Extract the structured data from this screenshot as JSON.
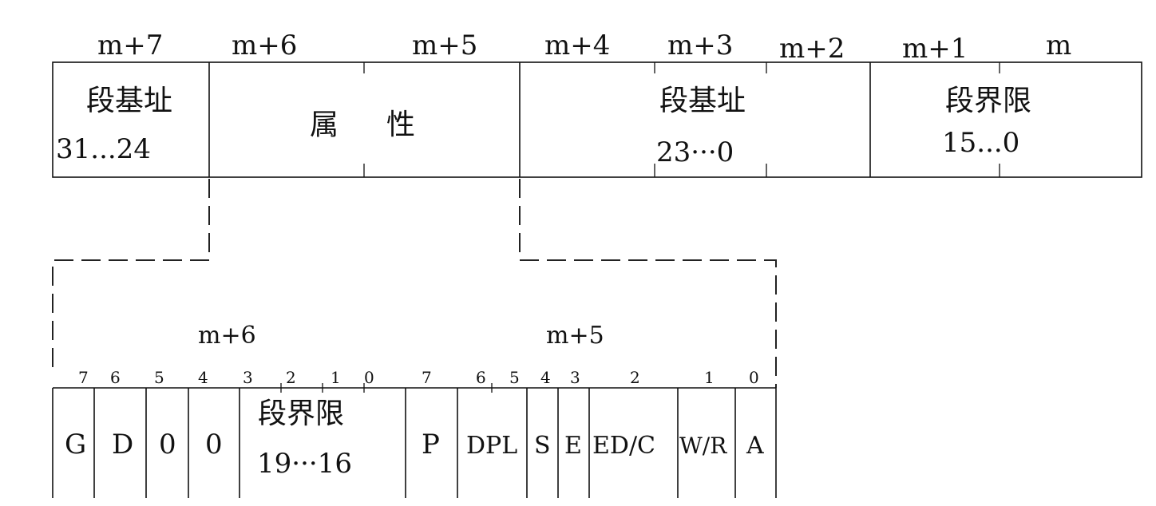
{
  "descriptor": {
    "byte_labels": [
      "m+7",
      "m+6",
      "m+5",
      "m+4",
      "m+3",
      "m+2",
      "m+1",
      "m"
    ],
    "fields": {
      "base_high": {
        "name": "段基址",
        "range": "31...24"
      },
      "attributes": {
        "char1": "属",
        "char2": "性"
      },
      "base_low": {
        "name": "段基址",
        "range": "23···0"
      },
      "limit_low": {
        "name": "段界限",
        "range": "15...0"
      }
    }
  },
  "attributes_detail": {
    "byte_labels": [
      "m+6",
      "m+5"
    ],
    "bit_numbers_left": [
      "7",
      "6",
      "5",
      "4",
      "3",
      "2",
      "1",
      "0"
    ],
    "bit_numbers_right": [
      "7",
      "6",
      "5",
      "4",
      "3",
      "2",
      "1",
      "0"
    ],
    "cells": {
      "g": "G",
      "d": "D",
      "zero1": "0",
      "zero2": "0",
      "limit_high_name": "段界限",
      "limit_high_range": "19···16",
      "p": "P",
      "dpl": "DPL",
      "s": "S",
      "e": "E",
      "edc": "ED/C",
      "wr": "W/R",
      "a": "A"
    }
  }
}
